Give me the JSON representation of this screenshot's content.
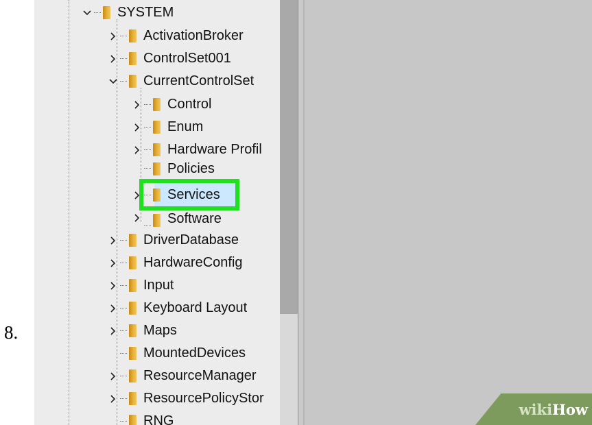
{
  "step": {
    "number": "8."
  },
  "tree": {
    "root": {
      "label": "SYSTEM",
      "expanded": true
    },
    "items": [
      {
        "label": "ActivationBroker",
        "expanded": false
      },
      {
        "label": "ControlSet001",
        "expanded": false
      },
      {
        "label": "CurrentControlSet",
        "expanded": true
      },
      {
        "label": "Control",
        "expanded": false
      },
      {
        "label": "Enum",
        "expanded": false
      },
      {
        "label": "Hardware Profil",
        "expanded": false
      },
      {
        "label": "Policies",
        "expanded": false
      },
      {
        "label": "Services",
        "expanded": false,
        "selected": true
      },
      {
        "label": "Software",
        "expanded": false
      },
      {
        "label": "DriverDatabase",
        "expanded": false
      },
      {
        "label": "HardwareConfig",
        "expanded": false
      },
      {
        "label": "Input",
        "expanded": false
      },
      {
        "label": "Keyboard Layout",
        "expanded": false
      },
      {
        "label": "Maps",
        "expanded": false
      },
      {
        "label": "MountedDevices",
        "expanded": false
      },
      {
        "label": "ResourceManager",
        "expanded": false
      },
      {
        "label": "ResourcePolicyStor",
        "expanded": false
      },
      {
        "label": "RNG",
        "expanded": false
      }
    ]
  },
  "watermark": {
    "part1": "wiki",
    "part2": "How"
  },
  "colors": {
    "highlight": "#1fe11f",
    "folder": "#e6b13a",
    "watermark_bg": "#7d9b5d"
  }
}
